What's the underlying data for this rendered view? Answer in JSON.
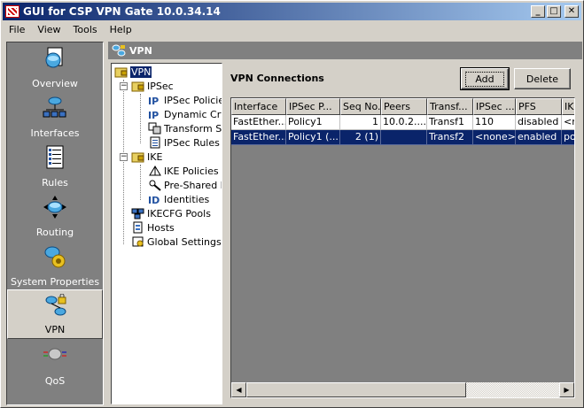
{
  "window": {
    "title": "GUI for CSP VPN Gate 10.0.34.14",
    "buttons": {
      "minimize": "_",
      "maximize": "□",
      "close": "✕"
    }
  },
  "menu": [
    "File",
    "View",
    "Tools",
    "Help"
  ],
  "nav": [
    {
      "label": "Overview",
      "icon": "overview-icon",
      "selected": false
    },
    {
      "label": "Interfaces",
      "icon": "interfaces-icon",
      "selected": false
    },
    {
      "label": "Rules",
      "icon": "rules-icon",
      "selected": false
    },
    {
      "label": "Routing",
      "icon": "routing-icon",
      "selected": false
    },
    {
      "label": "System Properties",
      "icon": "system-properties-icon",
      "selected": false
    },
    {
      "label": "VPN",
      "icon": "vpn-icon",
      "selected": true
    },
    {
      "label": "QoS",
      "icon": "qos-icon",
      "selected": false
    }
  ],
  "panel": {
    "header": "VPN"
  },
  "tree": {
    "root": "VPN",
    "ipsec": "IPSec",
    "ipsec_policies": "IPSec Policies",
    "dynamic_crypto": "Dynamic Cryp",
    "transform_sets": "Transform Se",
    "ipsec_rules": "IPSec Rules",
    "ike": "IKE",
    "ike_policies": "IKE Policies",
    "pre_shared": "Pre-Shared K",
    "identities": "Identities",
    "ikecfg_pools": "IKECFG Pools",
    "hosts": "Hosts",
    "global_settings": "Global Settings"
  },
  "content": {
    "title": "VPN Connections",
    "add_label": "Add",
    "delete_label": "Delete"
  },
  "table": {
    "columns": [
      "Interface",
      "IPSec P...",
      "Seq No.",
      "Peers",
      "Transf...",
      "IPSec ...",
      "PFS",
      "IK"
    ],
    "rows": [
      [
        "FastEther...",
        "Policy1",
        "1",
        "10.0.2....",
        "Transf1",
        "110",
        "disabled",
        "<r"
      ],
      [
        "FastEther...",
        "Policy1 (...",
        "2 (1)",
        "",
        "Transf2",
        "<none>",
        "enabled",
        "po"
      ]
    ],
    "selected_row": 1
  },
  "colors": {
    "title_start": "#0a246a",
    "title_end": "#a6caf0",
    "selection": "#0a246a",
    "nav_bg": "#808080"
  }
}
